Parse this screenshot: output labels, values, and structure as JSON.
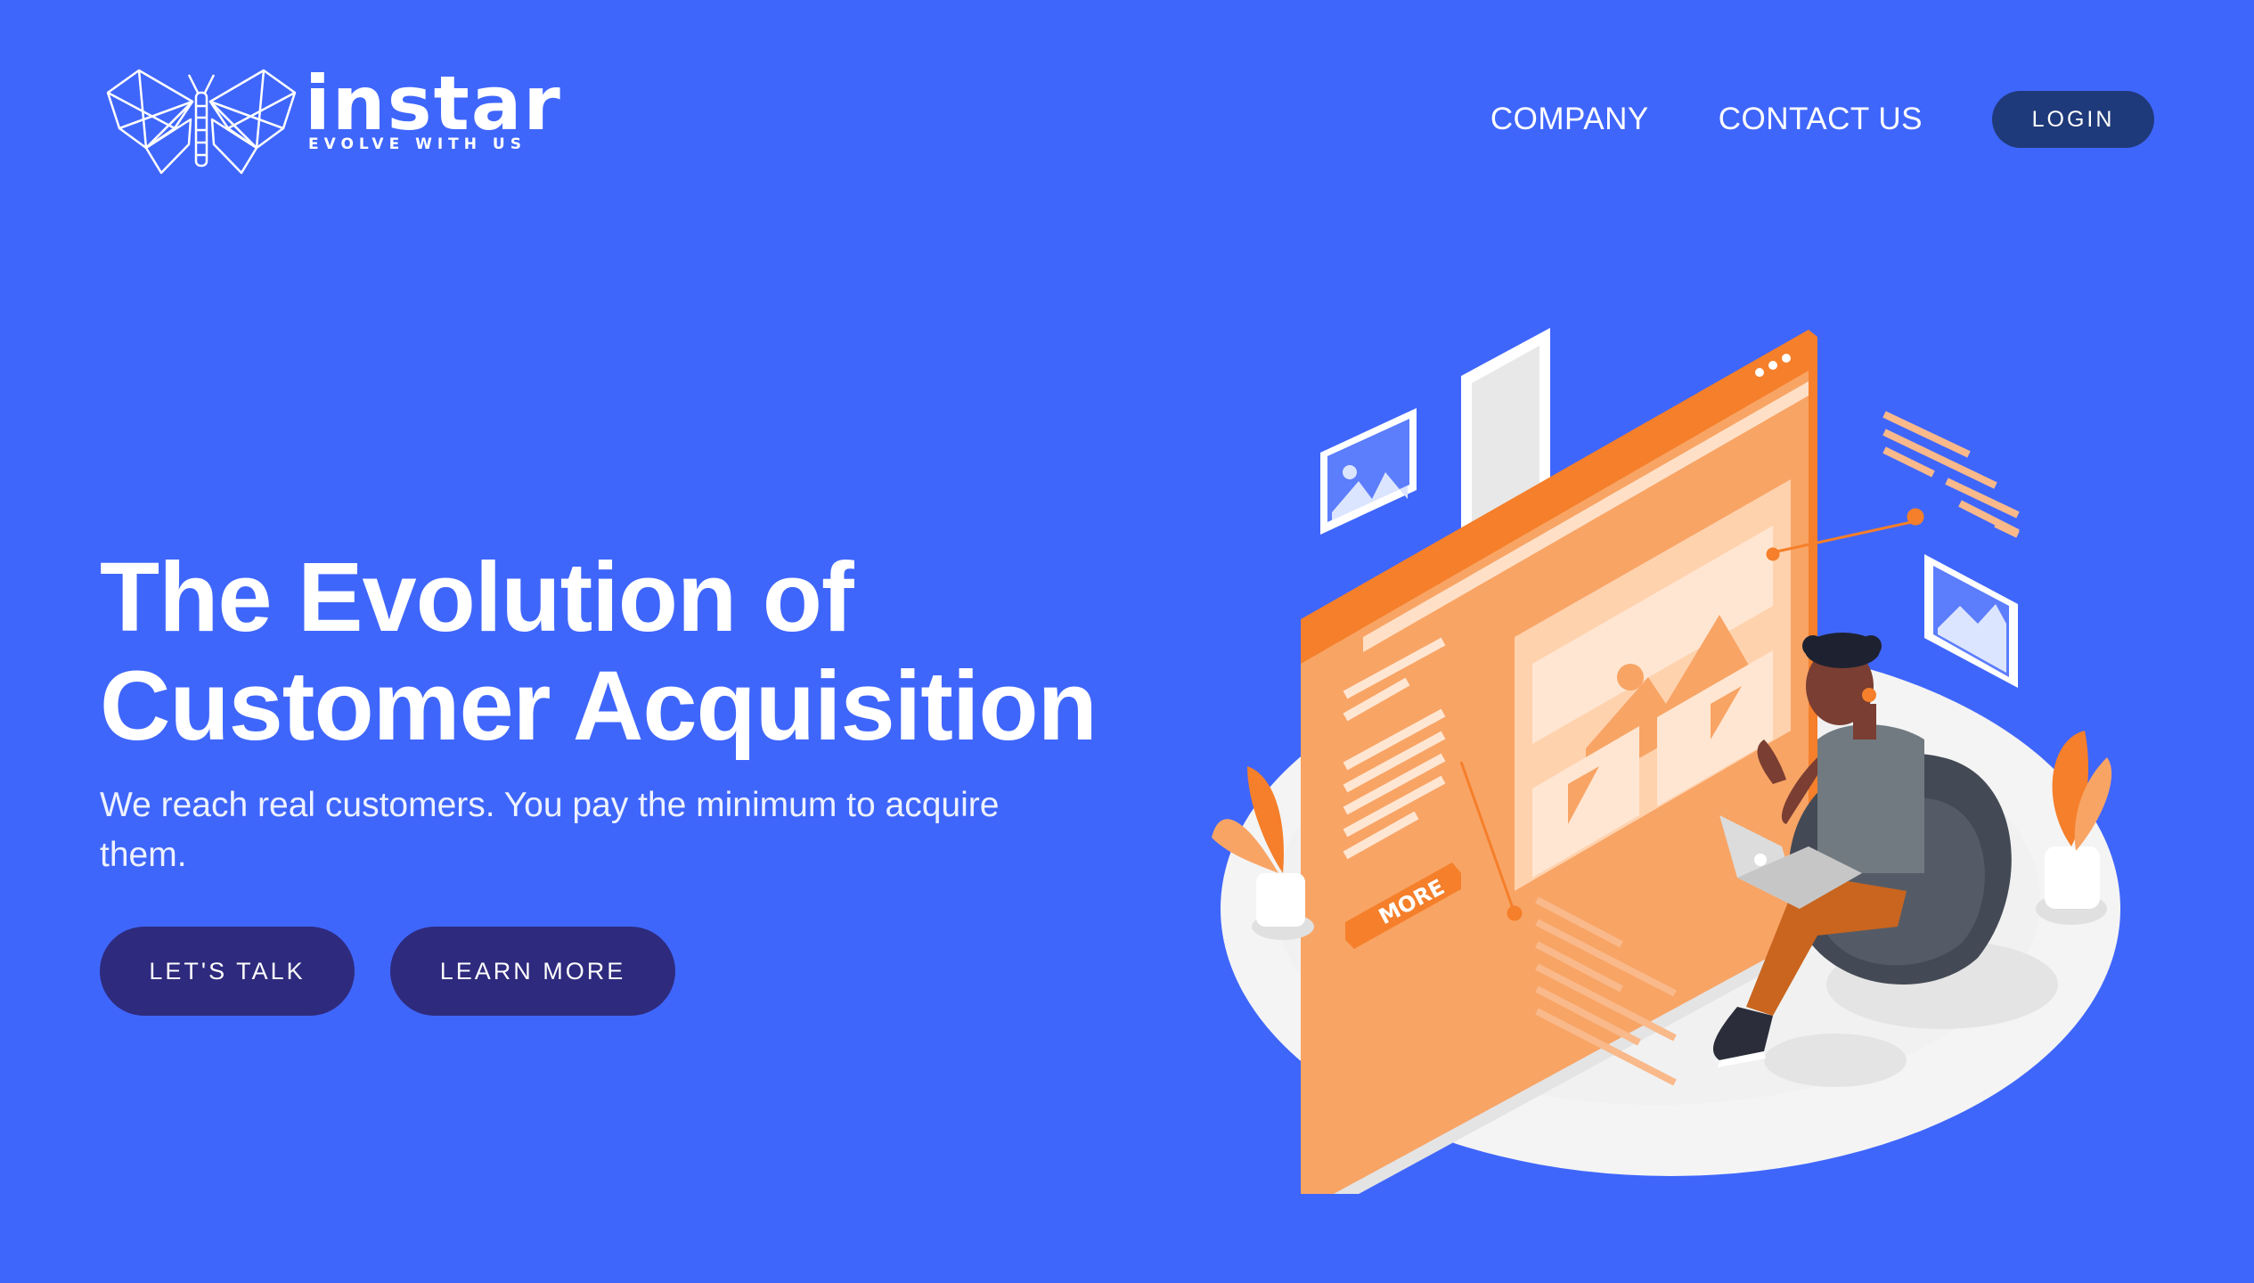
{
  "brand": {
    "name": "instar",
    "tagline": "EVOLVE WITH US",
    "logo_icon": "butterfly-icon"
  },
  "nav": {
    "company_label": "COMPANY",
    "contact_label": "CONTACT US",
    "login_label": "LOGIN"
  },
  "hero": {
    "title_line1": "The Evolution of",
    "title_line2": "Customer Acquisition",
    "subtitle": "We reach real customers. You pay the minimum to acquire them.",
    "cta_primary": "LET'S TALK",
    "cta_secondary": "LEARN MORE"
  },
  "illustration": {
    "more_label": "MORE"
  },
  "colors": {
    "background": "#3F66FB",
    "login_button": "#1F3A7A",
    "cta_button": "#2E2A7D",
    "accent_orange": "#F7914A",
    "platform": "#F4F4F4"
  }
}
